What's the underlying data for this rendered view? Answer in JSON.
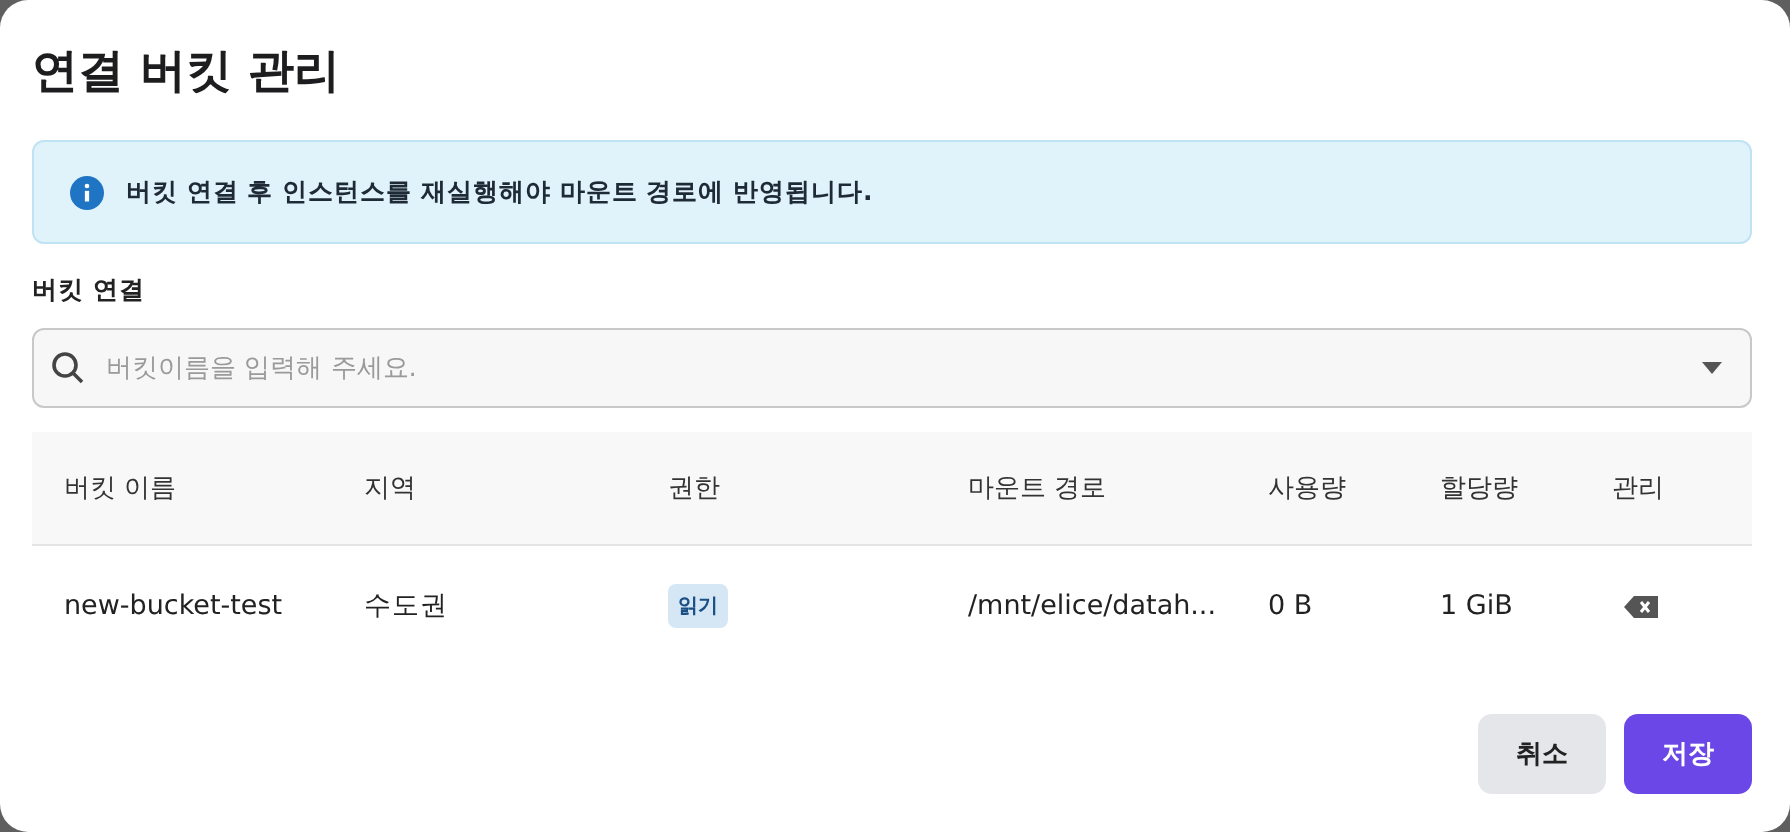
{
  "dialog": {
    "title": "연결 버킷 관리"
  },
  "notice": {
    "text": "버킷 연결 후 인스턴스를 재실행해야 마운트 경로에 반영됩니다."
  },
  "bucket_field": {
    "label": "버킷 연결",
    "placeholder": "버킷이름을 입력해 주세요."
  },
  "table": {
    "columns": [
      "버킷 이름",
      "지역",
      "권한",
      "마운트 경로",
      "사용량",
      "할당량",
      "관리"
    ],
    "rows": [
      {
        "name": "new-bucket-test",
        "region": "수도권",
        "permission": "읽기",
        "mount_path": "/mnt/elice/datah...",
        "usage": "0 B",
        "quota": "1 GiB"
      }
    ]
  },
  "buttons": [
    {
      "label": "취소",
      "kind": "secondary"
    },
    {
      "label": "저장",
      "kind": "primary"
    }
  ]
}
